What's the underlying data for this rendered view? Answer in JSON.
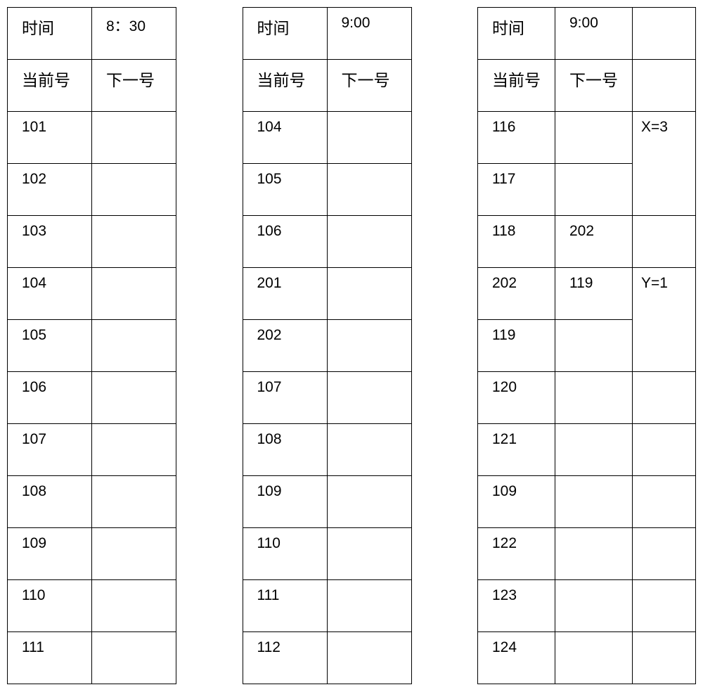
{
  "labels": {
    "time": "时间",
    "current": "当前号",
    "next": "下一号"
  },
  "tableA": {
    "time": "8：30",
    "rows": [
      {
        "c": "101",
        "n": ""
      },
      {
        "c": "102",
        "n": ""
      },
      {
        "c": "103",
        "n": ""
      },
      {
        "c": "104",
        "n": ""
      },
      {
        "c": "105",
        "n": ""
      },
      {
        "c": "106",
        "n": ""
      },
      {
        "c": "107",
        "n": ""
      },
      {
        "c": "108",
        "n": ""
      },
      {
        "c": "109",
        "n": ""
      },
      {
        "c": "110",
        "n": ""
      },
      {
        "c": "111",
        "n": ""
      }
    ]
  },
  "tableB": {
    "time": "9:00",
    "rows": [
      {
        "c": "104",
        "n": ""
      },
      {
        "c": "105",
        "n": ""
      },
      {
        "c": "106",
        "n": ""
      },
      {
        "c": "201",
        "n": ""
      },
      {
        "c": "202",
        "n": ""
      },
      {
        "c": "107",
        "n": ""
      },
      {
        "c": "108",
        "n": ""
      },
      {
        "c": "109",
        "n": ""
      },
      {
        "c": "110",
        "n": ""
      },
      {
        "c": "111",
        "n": ""
      },
      {
        "c": "112",
        "n": ""
      }
    ]
  },
  "tableC": {
    "time": "9:00",
    "annotations": {
      "x": "X=3",
      "y": "Y=1"
    },
    "rows": [
      {
        "c": "116",
        "n": ""
      },
      {
        "c": "117",
        "n": ""
      },
      {
        "c": "118",
        "n": "202"
      },
      {
        "c": "202",
        "n": "119"
      },
      {
        "c": "119",
        "n": ""
      },
      {
        "c": "120",
        "n": ""
      },
      {
        "c": "121",
        "n": ""
      },
      {
        "c": "109",
        "n": ""
      },
      {
        "c": "122",
        "n": ""
      },
      {
        "c": "123",
        "n": ""
      },
      {
        "c": "124",
        "n": ""
      }
    ]
  }
}
